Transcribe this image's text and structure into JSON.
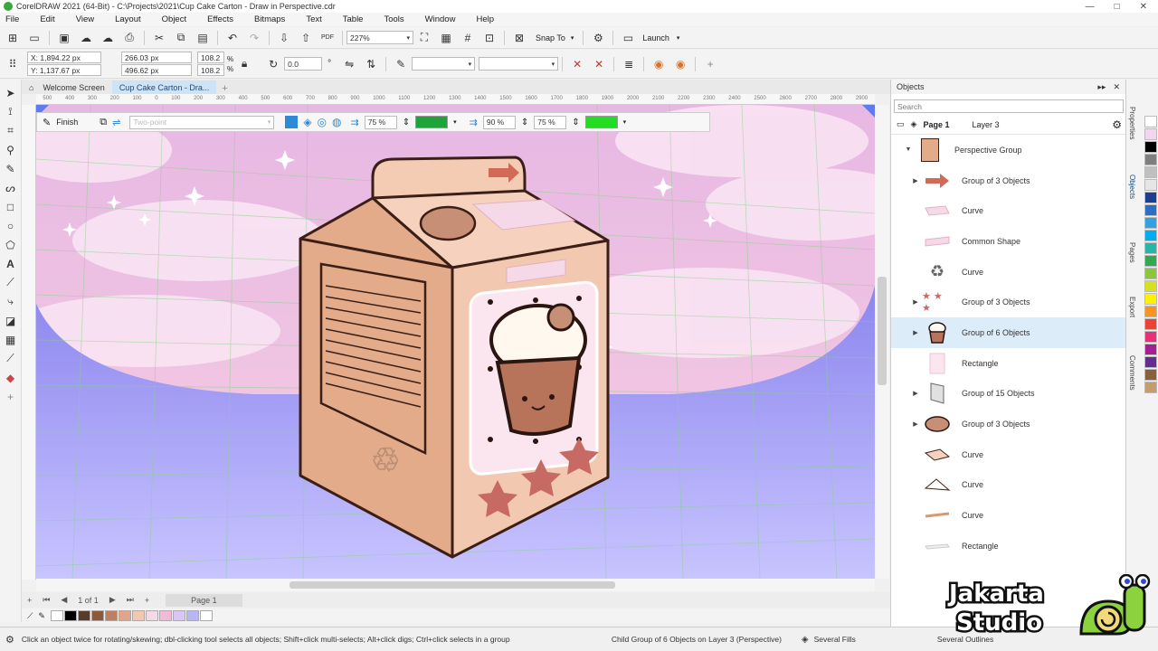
{
  "window": {
    "title": "CorelDRAW 2021 (64-Bit) - C:\\Projects\\2021\\Cup Cake Carton - Draw in Perspective.cdr",
    "controls": [
      "—",
      "□",
      "✕"
    ]
  },
  "menu": [
    "File",
    "Edit",
    "View",
    "Layout",
    "Object",
    "Effects",
    "Bitmaps",
    "Text",
    "Table",
    "Tools",
    "Window",
    "Help"
  ],
  "standard_toolbar": {
    "zoom_level": "227%",
    "snap_to_label": "Snap To",
    "launch_label": "Launch"
  },
  "property_bar": {
    "x": "X: 1,894.22 px",
    "y": "Y: 1,137.67 px",
    "width": "266.03 px",
    "height": "496.62 px",
    "scale_x": "108.2",
    "scale_y": "108.2",
    "percent": "%",
    "angle": "0.0",
    "angle_unit": "°"
  },
  "document_tabs": [
    {
      "label": "Welcome Screen",
      "active": false
    },
    {
      "label": "Cup Cake Carton - Dra...",
      "active": true
    }
  ],
  "ruler_ticks": [
    "500",
    "400",
    "300",
    "200",
    "100",
    "0",
    "100",
    "200",
    "300",
    "400",
    "500",
    "600",
    "700",
    "800",
    "900",
    "1000",
    "1100",
    "1200",
    "1300",
    "1400",
    "1500",
    "1600",
    "1700",
    "1800",
    "1900",
    "2000",
    "2100",
    "2200",
    "2300",
    "2400",
    "2500",
    "2600",
    "2700",
    "2800",
    "2900"
  ],
  "perspective_bar": {
    "finish_label": "Finish",
    "preset_placeholder": "Two-point",
    "opacity_1": "75 %",
    "opacity_2": "90 %",
    "opacity_3": "75 %",
    "grid_color_1": "#1fa33a",
    "grid_color_2": "#22dd22"
  },
  "page_nav": {
    "counter": "1 of 1",
    "page_tab": "Page 1"
  },
  "doc_palette": [
    "#ffffff",
    "#000000",
    "#5a3a2a",
    "#8a5a3a",
    "#c08060",
    "#e3a48a",
    "#f2c9b0",
    "#f6d9e8",
    "#f3b9d9",
    "#d9c6f4",
    "#b9b6f5",
    "#ffffff"
  ],
  "status": {
    "hint": "Click an object twice for rotating/skewing; dbl-clicking tool selects all objects; Shift+click multi-selects; Alt+click digs; Ctrl+click selects in a group",
    "selection": "Child Group of 6 Objects on Layer 3  (Perspective)",
    "fill_label": "Several Fills",
    "outline_label": "Several Outlines"
  },
  "objects_docker": {
    "title": "Objects",
    "search_placeholder": "Search",
    "page_label": "Page 1",
    "layer_label": "Layer 3",
    "root": "Perspective Group",
    "items": [
      {
        "label": "Group of 3 Objects",
        "expandable": true,
        "thumb": "arrow",
        "selected": false
      },
      {
        "label": "Curve",
        "expandable": false,
        "thumb": "pink-band",
        "selected": false
      },
      {
        "label": "Common Shape",
        "expandable": false,
        "thumb": "ribbon",
        "selected": false
      },
      {
        "label": "Curve",
        "expandable": false,
        "thumb": "recycle",
        "selected": false
      },
      {
        "label": "Group of 3 Objects",
        "expandable": true,
        "thumb": "stars",
        "selected": false
      },
      {
        "label": "Group of 6 Objects",
        "expandable": true,
        "thumb": "cupcake",
        "selected": true
      },
      {
        "label": "Rectangle",
        "expandable": false,
        "thumb": "rect-light",
        "selected": false
      },
      {
        "label": "Group of 15 Objects",
        "expandable": true,
        "thumb": "panel",
        "selected": false
      },
      {
        "label": "Group of 3 Objects",
        "expandable": true,
        "thumb": "cookie",
        "selected": false
      },
      {
        "label": "Curve",
        "expandable": false,
        "thumb": "diamond",
        "selected": false
      },
      {
        "label": "Curve",
        "expandable": false,
        "thumb": "triangle",
        "selected": false
      },
      {
        "label": "Curve",
        "expandable": false,
        "thumb": "stroke",
        "selected": false
      },
      {
        "label": "Rectangle",
        "expandable": false,
        "thumb": "flat-rect",
        "selected": false
      }
    ]
  },
  "side_tabs": [
    "Properties",
    "Objects",
    "Pages",
    "Export",
    "Comments"
  ],
  "color_palette": [
    "#ffffff",
    "#f4d4f0",
    "#000000",
    "#7f7f7f",
    "#c0c0c0",
    "#e6e6e6",
    "#1c3f94",
    "#2b6fc4",
    "#35a0e0",
    "#00aef0",
    "#26b7a8",
    "#33a853",
    "#8cc63f",
    "#d7df21",
    "#fff200",
    "#f7941d",
    "#ef4136",
    "#e7317a",
    "#a3218e",
    "#662d91",
    "#8b5e3c",
    "#c69c6d"
  ],
  "watermark": {
    "line1": "Jakarta",
    "line2": "Studio"
  }
}
